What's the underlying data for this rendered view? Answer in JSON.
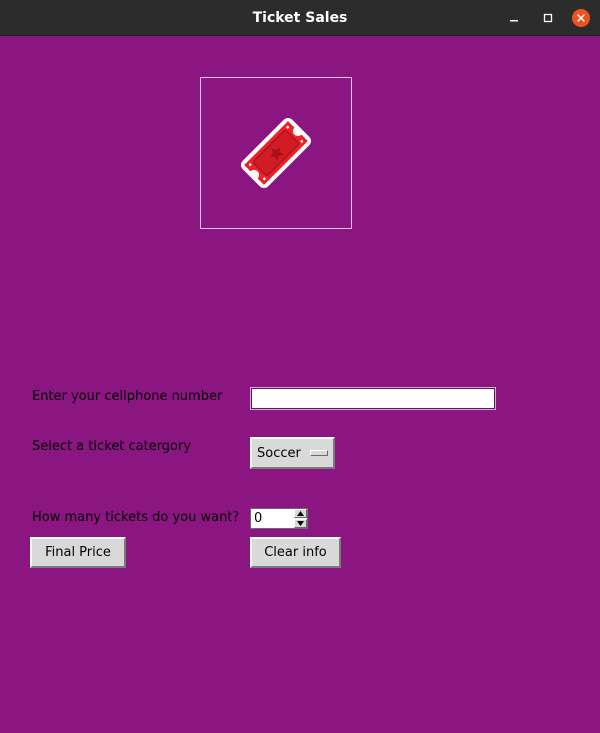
{
  "window": {
    "title": "Ticket Sales",
    "background": "#8b1581",
    "controls": {
      "minimize_icon": "minimize-icon",
      "maximize_icon": "maximize-icon",
      "close_icon": "close-icon"
    }
  },
  "form": {
    "image_icon": "ticket-icon",
    "phone_label": "Enter your cellphone number",
    "phone_value": "",
    "category_label": "Select a ticket catergory",
    "category_selected": "Soccer",
    "quantity_label": "How many tickets do you want?",
    "quantity_value": "0",
    "final_price_button": "Final Price",
    "clear_button": "Clear info"
  }
}
